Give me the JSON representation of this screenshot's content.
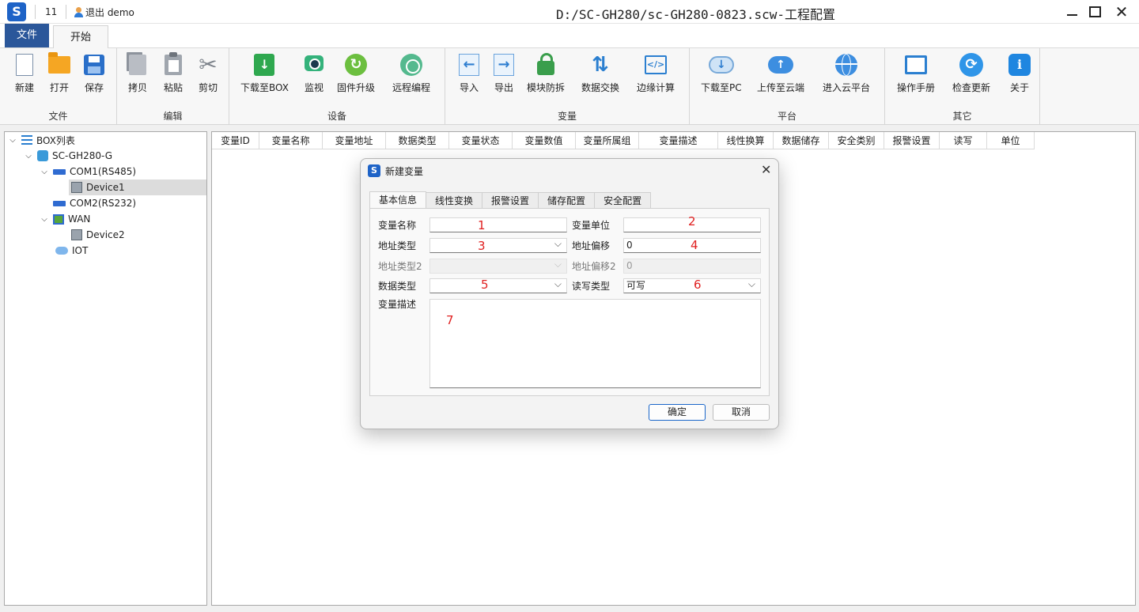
{
  "titlebar": {
    "quick_number": "11",
    "user_action": "退出 demo",
    "window_title": "D:/SC-GH280/sc-GH280-0823.scw-工程配置"
  },
  "ribbon_tabs": {
    "file": "文件",
    "start": "开始"
  },
  "ribbon": {
    "groups": [
      {
        "label": "文件",
        "buttons": [
          "新建",
          "打开",
          "保存"
        ]
      },
      {
        "label": "编辑",
        "buttons": [
          "拷贝",
          "粘贴",
          "剪切"
        ]
      },
      {
        "label": "设备",
        "buttons": [
          "下载至BOX",
          "监视",
          "固件升级",
          "远程编程"
        ]
      },
      {
        "label": "变量",
        "buttons": [
          "导入",
          "导出",
          "模块防拆",
          "数据交换",
          "边缘计算"
        ]
      },
      {
        "label": "平台",
        "buttons": [
          "下载至PC",
          "上传至云端",
          "进入云平台"
        ]
      },
      {
        "label": "其它",
        "buttons": [
          "操作手册",
          "检查更新",
          "关于"
        ]
      }
    ]
  },
  "tree": {
    "items": [
      {
        "label": "BOX列表",
        "icon": "list-icon"
      },
      {
        "label": "SC-GH280-G",
        "icon": "box-icon"
      },
      {
        "label": "COM1(RS485)",
        "icon": "serial-port-icon"
      },
      {
        "label": "Device1",
        "icon": "device-icon"
      },
      {
        "label": "COM2(RS232)",
        "icon": "serial-port-icon"
      },
      {
        "label": "WAN",
        "icon": "wan-icon"
      },
      {
        "label": "Device2",
        "icon": "device-icon"
      },
      {
        "label": "IOT",
        "icon": "cloud-icon"
      }
    ],
    "selected": "Device1"
  },
  "grid": {
    "columns": [
      "变量ID",
      "变量名称",
      "变量地址",
      "数据类型",
      "变量状态",
      "变量数值",
      "变量所属组",
      "变量描述",
      "线性换算",
      "数据储存",
      "安全类别",
      "报警设置",
      "读写",
      "单位"
    ]
  },
  "dialog": {
    "title": "新建变量",
    "tabs": [
      "基本信息",
      "线性变换",
      "报警设置",
      "储存配置",
      "安全配置"
    ],
    "active_tab": "基本信息",
    "fields": {
      "var_name_label": "变量名称",
      "var_name_value": "",
      "var_unit_label": "变量单位",
      "var_unit_value": "",
      "addr_type_label": "地址类型",
      "addr_type_value": "",
      "addr_offset_label": "地址偏移",
      "addr_offset_value": "0",
      "addr_type2_label": "地址类型2",
      "addr_type2_value": "",
      "addr_offset2_label": "地址偏移2",
      "addr_offset2_value": "0",
      "data_type_label": "数据类型",
      "data_type_value": "",
      "rw_type_label": "读写类型",
      "rw_type_value": "可写",
      "desc_label": "变量描述"
    },
    "annotations": [
      "1",
      "2",
      "3",
      "4",
      "5",
      "6",
      "7"
    ],
    "ok_label": "确定",
    "cancel_label": "取消"
  },
  "colors": {
    "accent": "#2b579a",
    "annotation": "#e02020",
    "primary_button_border": "#1a66c9"
  }
}
